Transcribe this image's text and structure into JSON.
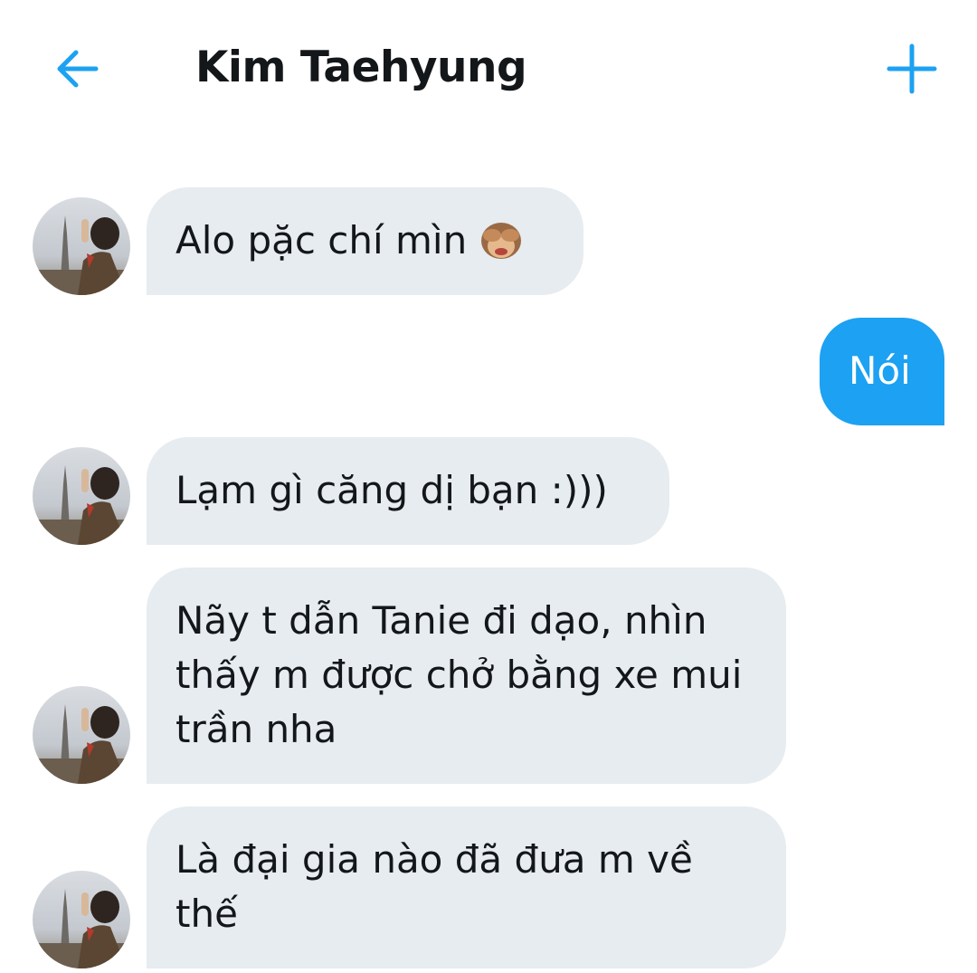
{
  "header": {
    "title": "Kim Taehyung",
    "back_icon": "arrow-left-icon",
    "add_icon": "plus-icon",
    "accent_color": "#1da1f2"
  },
  "messages": [
    {
      "direction": "incoming",
      "text": "Alo pặc chí mìn",
      "emoji": "see-no-evil-monkey-icon"
    },
    {
      "direction": "outgoing",
      "text": "Nói"
    },
    {
      "direction": "incoming",
      "text": "Lạm gì căng dị bạn :)))"
    },
    {
      "direction": "incoming",
      "text": "Nãy t dẫn Tanie đi dạo, nhìn thấy m được chở bằng xe mui trần nha"
    },
    {
      "direction": "incoming",
      "text": "Là đại gia nào đã đưa m về thế"
    }
  ],
  "colors": {
    "incoming_bubble": "#e6ecf0",
    "outgoing_bubble": "#1da1f2"
  }
}
